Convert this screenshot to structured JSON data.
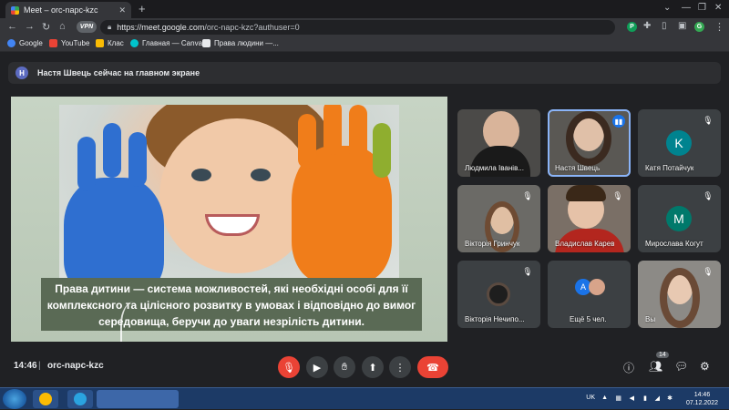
{
  "browser": {
    "tab_title": "Meet – orc-napc-kzc",
    "vpn_label": "VPN",
    "url_host": "https://meet.google.com",
    "url_path": "/orc-napc-kzc?authuser=0",
    "extensions": [
      "P",
      "G"
    ]
  },
  "bookmarks": [
    {
      "label": "Google",
      "color": "#4285f4"
    },
    {
      "label": "YouTube",
      "color": "#ea4335"
    },
    {
      "label": "Клас",
      "color": "#fbbc04"
    },
    {
      "label": "Главная — Canva",
      "color": "#00c4cc"
    },
    {
      "label": "Права людини —...",
      "color": "#e8eaed"
    }
  ],
  "banner": {
    "avatar_letter": "Н",
    "text": "Настя Швець сейчас на главном экране"
  },
  "presentation": {
    "caption": "Права дитини — система можливостей, які необхідні особі для її комплексного та цілісного розвитку в умовах і відповідно до вимог середовища, беручи до уваги незрілість дитини."
  },
  "participants": [
    {
      "name": "Людмила Іванів...",
      "type": "video",
      "muted": false
    },
    {
      "name": "Настя Швець",
      "type": "video",
      "muted": false,
      "speaking": true
    },
    {
      "name": "Катя Потайчук",
      "type": "letter",
      "letter": "K",
      "color": "#00838f",
      "muted": true
    },
    {
      "name": "Вікторія Гринчук",
      "type": "video",
      "muted": true
    },
    {
      "name": "Владислав Карев",
      "type": "video",
      "muted": true
    },
    {
      "name": "Мирослава Когут",
      "type": "letter",
      "letter": "M",
      "color": "#00796b",
      "muted": true
    },
    {
      "name": "Вікторія Нечипо...",
      "type": "video",
      "muted": true
    },
    {
      "name": "Ещё 5 чел.",
      "type": "more",
      "letter": "A"
    },
    {
      "name": "Вы",
      "type": "video",
      "muted": true
    }
  ],
  "controls": {
    "time": "14:46",
    "separator": "|",
    "meeting_code": "orc-napc-kzc",
    "participant_count": "14"
  },
  "taskbar": {
    "lang": "UK",
    "clock_time": "14:46",
    "clock_date": "07.12.2022"
  },
  "colors": {
    "accent": "#8ab4f8",
    "end_call": "#ea4335",
    "background": "#202124"
  }
}
